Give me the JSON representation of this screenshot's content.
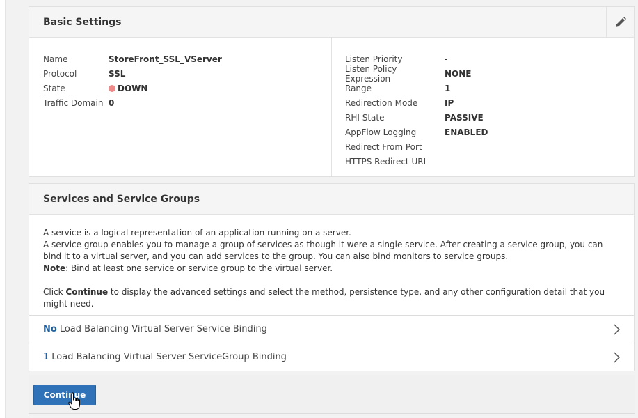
{
  "basic_settings": {
    "title": "Basic Settings",
    "left": [
      {
        "label": "Name",
        "value": "StoreFront_SSL_VServer"
      },
      {
        "label": "Protocol",
        "value": "SSL"
      },
      {
        "label": "State",
        "value": "DOWN"
      },
      {
        "label": "Traffic Domain",
        "value": "0"
      }
    ],
    "right": [
      {
        "label": "Listen Priority",
        "value": "-"
      },
      {
        "label": "Listen Policy Expression",
        "value": "NONE"
      },
      {
        "label": "Range",
        "value": "1"
      },
      {
        "label": "Redirection Mode",
        "value": "IP"
      },
      {
        "label": "RHI State",
        "value": "PASSIVE"
      },
      {
        "label": "AppFlow Logging",
        "value": "ENABLED"
      },
      {
        "label": "Redirect From Port",
        "value": ""
      },
      {
        "label": "HTTPS Redirect URL",
        "value": ""
      }
    ],
    "state_color": "#ee8a8a"
  },
  "services": {
    "title": "Services and Service Groups",
    "line1": "A service is a logical representation of an application running on a server.",
    "line2": "A service group enables you to manage a group of services as though it were a single service. After creating a service group, you can bind it to a virtual server, and you can add services to the group. You can also bind monitors to service groups.",
    "note_label": "Note",
    "note_text": ": Bind at least one service or service group to the virtual server.",
    "click_prefix": "Click ",
    "click_bold": "Continue",
    "click_suffix": " to display the advanced settings and select the method, persistence type, and any other configuration detail that you might need.",
    "bindings": [
      {
        "count": "No",
        "label": "Load Balancing Virtual Server Service Binding"
      },
      {
        "count": "1",
        "label": "Load Balancing Virtual Server ServiceGroup Binding"
      }
    ]
  },
  "continue_label": "Continue",
  "colors": {
    "accent": "#2f72b8",
    "link": "#1f5f9e"
  }
}
